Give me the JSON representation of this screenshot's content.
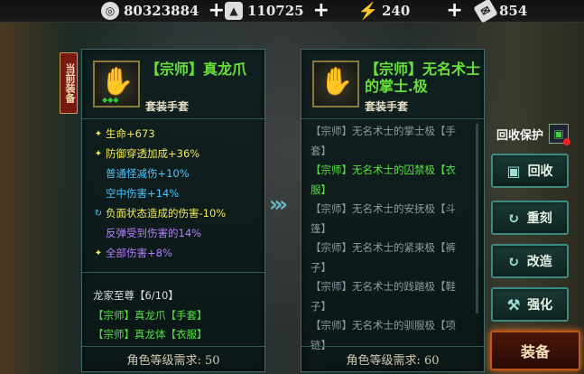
{
  "topbar": {
    "coins": "80323884",
    "silver": "110725",
    "energy": "240",
    "tickets": "854"
  },
  "equip_tag": "当前装备",
  "current_item": {
    "title": "【宗师】真龙爪",
    "subtitle": "套装手套",
    "stats": [
      {
        "icon": "wing-icon",
        "text": "生命+673",
        "color": "yellow"
      },
      {
        "icon": "wing-icon",
        "text": "防御穿透加成+36%",
        "color": "yellow"
      },
      {
        "icon": "",
        "text": "普通怪减伤+10%",
        "color": "cyan"
      },
      {
        "icon": "",
        "text": "空中伤害+14%",
        "color": "cyan"
      },
      {
        "icon": "cycle-icon",
        "text": "负面状态造成的伤害-10%",
        "color": "yellow"
      },
      {
        "icon": "",
        "text": "反弹受到伤害的14%",
        "color": "violet"
      },
      {
        "icon": "wing-icon",
        "text": "全部伤害+8%",
        "color": "violet"
      }
    ],
    "set_name": "龙家至尊【6/10】",
    "set_pieces": [
      "【宗师】真龙爪【手套】",
      "【宗师】真龙体【衣服】"
    ],
    "requirement": "角色等级需求: 50"
  },
  "compare_item": {
    "title": "【宗师】无名术士的掌士.极",
    "subtitle": "套装手套",
    "set_pieces": [
      {
        "text": "【宗师】无名术士的掌士极【手套】",
        "active": false
      },
      {
        "text": "【宗师】无名术士的囚禁极【衣服】",
        "active": true
      },
      {
        "text": "【宗师】无名术士的安抚极【斗篷】",
        "active": false
      },
      {
        "text": "【宗师】无名术士的紧束极【裤子】",
        "active": false
      },
      {
        "text": "【宗师】无名术士的践踏极【鞋子】",
        "active": false
      },
      {
        "text": "【宗师】无名术士的驯服极【项链】",
        "active": false
      }
    ],
    "requirement": "角色等级需求: 60"
  },
  "actions": {
    "protect_label": "回收保护",
    "recycle": "回收",
    "reforge": "重刻",
    "refine": "改造",
    "enhance": "强化",
    "equip": "装备"
  }
}
